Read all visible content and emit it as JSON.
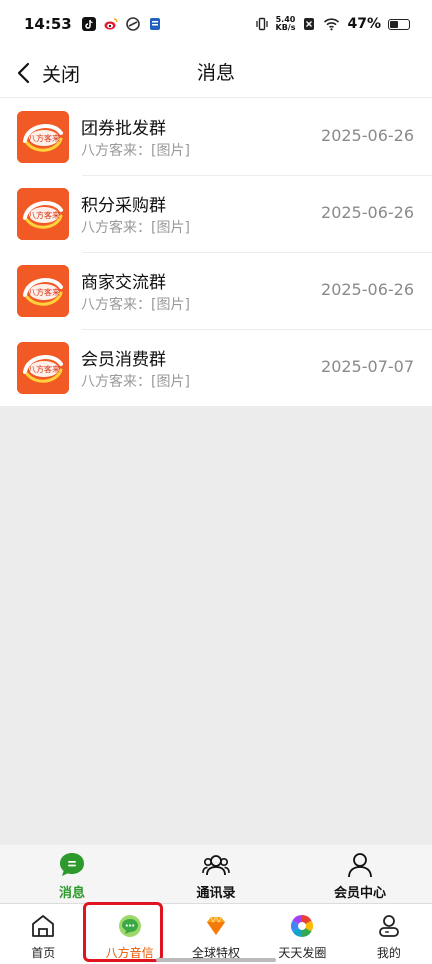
{
  "status_bar": {
    "time": "14:53",
    "net_speed_value": "5.40",
    "net_speed_unit": "KB/s",
    "battery_percent": "47%",
    "battery_level": 0.47
  },
  "header": {
    "close_label": "关闭",
    "title": "消息"
  },
  "chats": [
    {
      "name": "团券批发群",
      "preview": "八方客来：[图片]",
      "date": "2025-06-26",
      "avatar_text": "八方客来"
    },
    {
      "name": "积分采购群",
      "preview": "八方客来：[图片]",
      "date": "2025-06-26",
      "avatar_text": "八方客来"
    },
    {
      "name": "商家交流群",
      "preview": "八方客来：[图片]",
      "date": "2025-06-26",
      "avatar_text": "八方客来"
    },
    {
      "name": "会员消费群",
      "preview": "八方客来：[图片]",
      "date": "2025-07-07",
      "avatar_text": "八方客来"
    }
  ],
  "inner_tabs": [
    {
      "label": "消息",
      "icon": "chat-bubble-icon",
      "active": true
    },
    {
      "label": "通讯录",
      "icon": "contacts-icon",
      "active": false
    },
    {
      "label": "会员中心",
      "icon": "person-icon",
      "active": false
    }
  ],
  "bottom_nav": [
    {
      "label": "首页",
      "icon": "home-icon"
    },
    {
      "label": "八方音信",
      "icon": "message-icon",
      "active": true
    },
    {
      "label": "全球特权",
      "icon": "diamond-icon"
    },
    {
      "label": "天天发圈",
      "icon": "aperture-icon"
    },
    {
      "label": "我的",
      "icon": "profile-icon"
    }
  ],
  "colors": {
    "accent_green": "#2e9a2e",
    "active_orange": "#e65a00",
    "avatar_orange": "#f15a24",
    "highlight_red": "#e0141e"
  }
}
